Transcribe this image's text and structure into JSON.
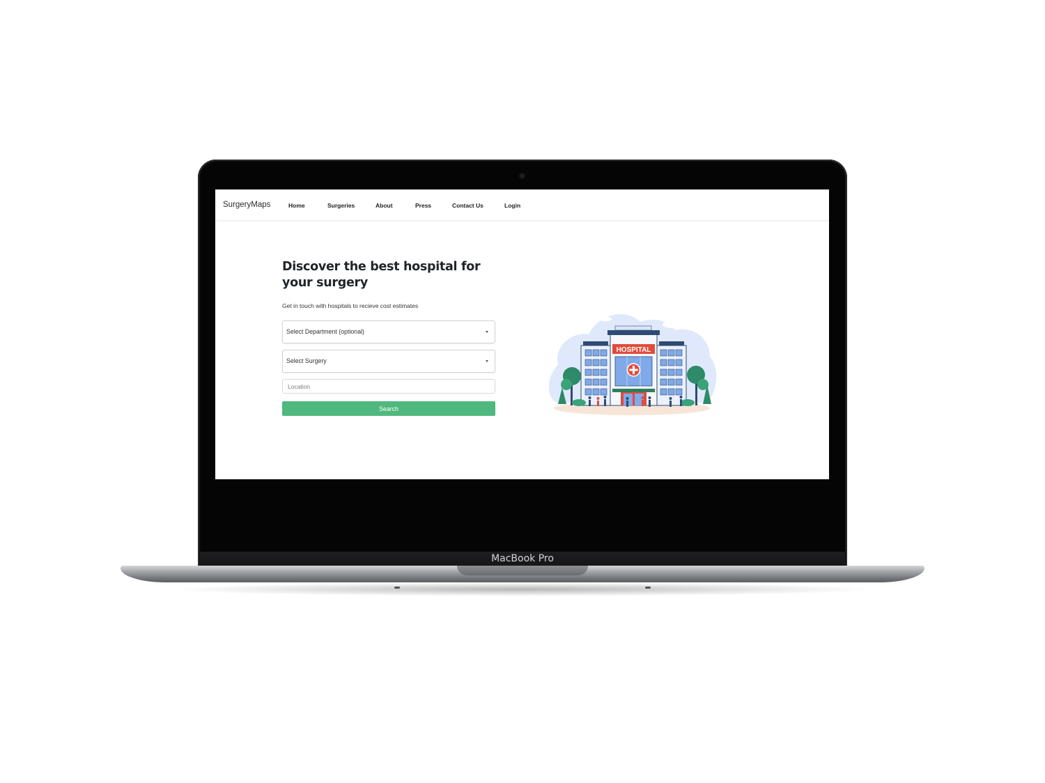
{
  "device": {
    "brand_label": "MacBook Pro"
  },
  "navbar": {
    "logo": "SurgeryMaps",
    "links": [
      "Home",
      "Surgeries",
      "About",
      "Press",
      "Contact Us",
      "Login"
    ]
  },
  "hero": {
    "headline": "Discover the best hospital for your surgery",
    "subheadline": "Get in touch with hospitals to recieve cost estimates",
    "department_select": "Select Department (optional)",
    "surgery_select": "Select Surgery",
    "location_placeholder": "Location",
    "search_label": "Search"
  },
  "illustration": {
    "sign_text": "HOSPITAL"
  },
  "colors": {
    "accent": "#4fb87e",
    "sign_red": "#e24b3b",
    "building_blue": "#7fa9e8"
  }
}
